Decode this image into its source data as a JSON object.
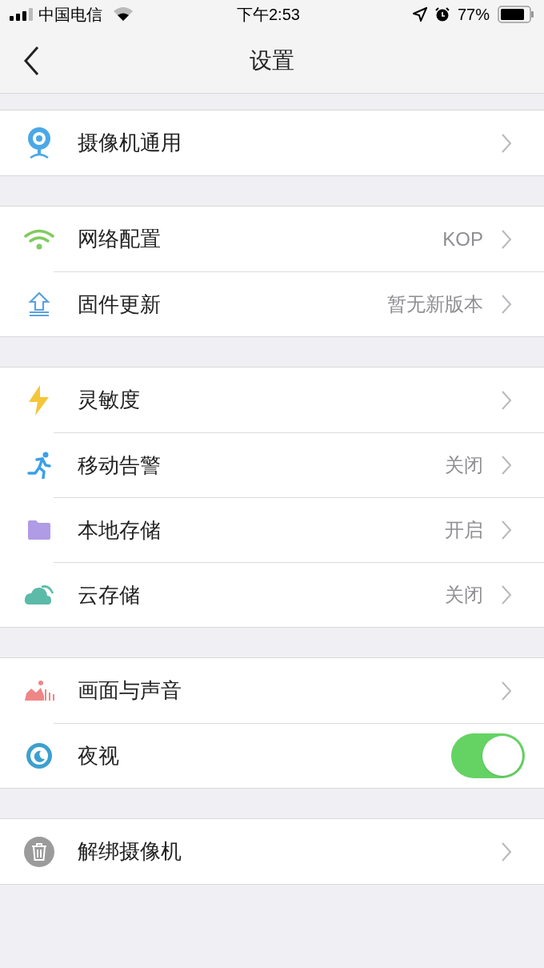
{
  "status_bar": {
    "carrier": "中国电信",
    "time": "下午2:53",
    "battery": "77%"
  },
  "nav": {
    "title": "设置"
  },
  "groups": [
    [
      {
        "label": "摄像机通用",
        "kind": "link"
      }
    ],
    [
      {
        "label": "网络配置",
        "value": "KOP",
        "kind": "link"
      },
      {
        "label": "固件更新",
        "value": "暂无新版本",
        "kind": "link"
      }
    ],
    [
      {
        "label": "灵敏度",
        "kind": "link"
      },
      {
        "label": "移动告警",
        "value": "关闭",
        "kind": "link"
      },
      {
        "label": "本地存储",
        "value": "开启",
        "kind": "link"
      },
      {
        "label": "云存储",
        "value": "关闭",
        "kind": "link"
      }
    ],
    [
      {
        "label": "画面与声音",
        "kind": "link"
      },
      {
        "label": "夜视",
        "kind": "toggle",
        "on": true
      }
    ],
    [
      {
        "label": "解绑摄像机",
        "kind": "link"
      }
    ]
  ]
}
